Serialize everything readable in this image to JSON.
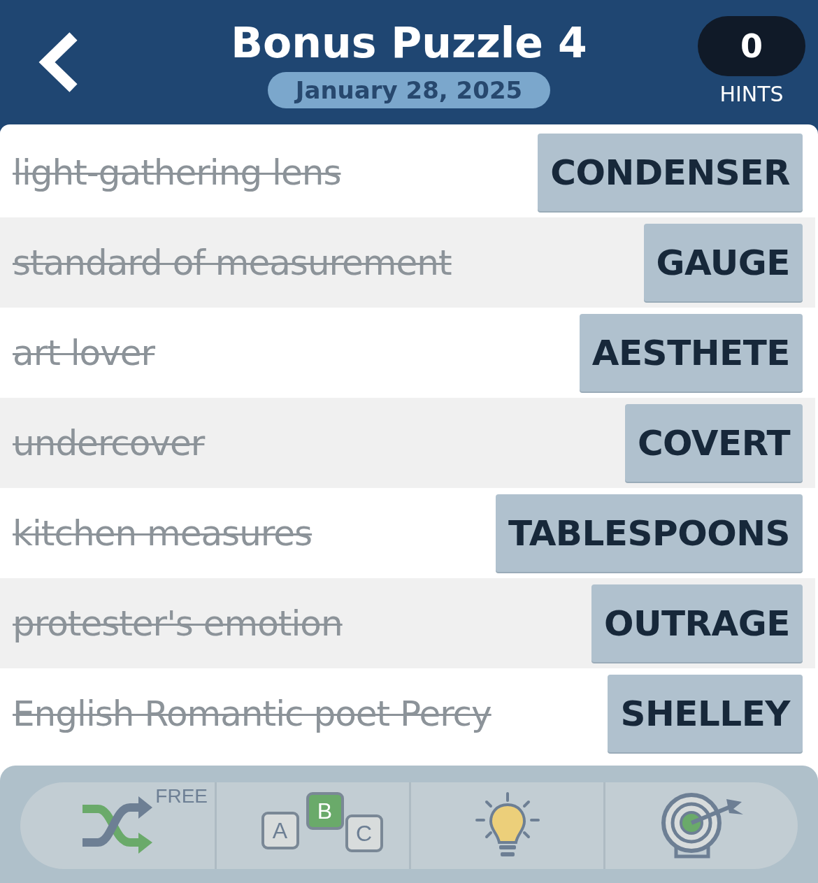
{
  "header": {
    "title": "Bonus Puzzle 4",
    "date": "January 28, 2025",
    "hints": {
      "count": "0",
      "label": "HINTS"
    }
  },
  "clues": [
    {
      "clue": "light-gathering lens",
      "answer": "CONDENSER",
      "solved": true
    },
    {
      "clue": "standard of measurement",
      "answer": "GAUGE",
      "solved": true
    },
    {
      "clue": "art lover",
      "answer": "AESTHETE",
      "solved": true
    },
    {
      "clue": "undercover",
      "answer": "COVERT",
      "solved": true
    },
    {
      "clue": "kitchen measures",
      "answer": "TABLESPOONS",
      "solved": true
    },
    {
      "clue": "protester's emotion",
      "answer": "OUTRAGE",
      "solved": true
    },
    {
      "clue": "English Romantic poet Percy",
      "answer": "SHELLEY",
      "solved": true
    }
  ],
  "toolbar": [
    {
      "kind": "shuffle",
      "badge": "FREE"
    },
    {
      "kind": "letters",
      "letters": [
        "A",
        "B",
        "C"
      ]
    },
    {
      "kind": "hint"
    },
    {
      "kind": "target"
    }
  ]
}
